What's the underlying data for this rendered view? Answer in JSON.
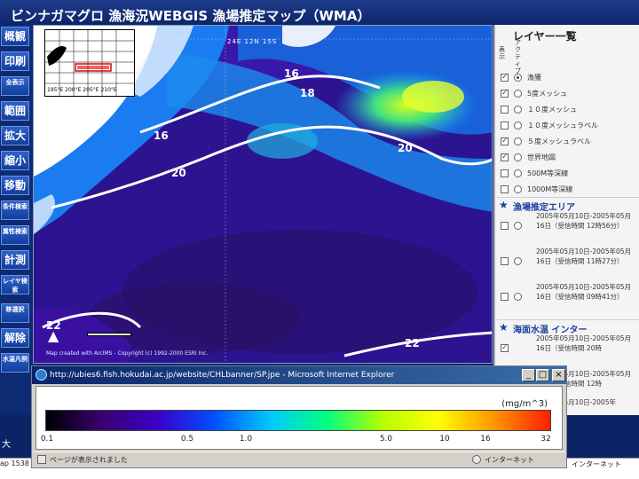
{
  "title": "ビンナガマグロ 漁海況WEBGIS 漁場推定マップ（WMA）",
  "toolbar": [
    "概観",
    "印刷",
    "全表示",
    "範囲",
    "拡大",
    "縮小",
    "移動",
    "条件検索",
    "属性検索",
    "計測",
    "レイヤ検索",
    "移選択",
    "解除",
    "水温凡例"
  ],
  "map": {
    "contour_labels": [
      "16",
      "18",
      "20",
      "20",
      "16",
      "22",
      "22"
    ],
    "coordinate_readout": "24E 12N 15S",
    "copyright": "Map created with ArcIMS - Copyright (c) 1992-2000 ESRI Inc.",
    "north_label": "N",
    "inset_label": "195°E 200°E 205°E 210°E"
  },
  "layer_panel": {
    "title": "レイヤー一覧",
    "col_headers": [
      "表示",
      "アクティブ"
    ],
    "layers": [
      {
        "label": "漁獲",
        "checked": true,
        "active": true
      },
      {
        "label": "5度メッシュ",
        "checked": true,
        "active": false
      },
      {
        "label": "１０度メッシュ",
        "checked": false,
        "active": false
      },
      {
        "label": "１０度メッシュラベル",
        "checked": false,
        "active": false
      },
      {
        "label": "５度メッシュラベル",
        "checked": true,
        "active": false
      },
      {
        "label": "世界地図",
        "checked": true,
        "active": false
      },
      {
        "label": "500M等深線",
        "checked": false,
        "active": false
      },
      {
        "label": "1000M等深線",
        "checked": false,
        "active": false
      }
    ],
    "section_fishing": "漁場推定エリア",
    "fishing_areas": [
      "2005年05月10日-2005年05月16日（受信時間 12時56分）",
      "2005年05月10日-2005年05月16日（受信時間 11時27分）",
      "2005年05月10日-2005年05月16日（受信時間 09時41分）"
    ],
    "section_sst": "海面水温 インター",
    "sst_items": [
      "2005年05月10日-2005年05月16日（受信時間 20時",
      "2005年05月10日-2005年05月16日（受信時間 12時",
      "2005年05月10日-2005年"
    ]
  },
  "popup": {
    "title": "http://ubies6.fish.hokudai.ac.jp/website/CHLbanner/SP.jpe - Microsoft Internet Explorer",
    "unit": "(mg/m^3)",
    "ticks": [
      "0.1",
      "0.5",
      "1.0",
      "5.0",
      "10",
      "16",
      "32"
    ],
    "status_left": "ページが表示されました",
    "status_right": "インターネット",
    "colors": [
      "#000000",
      "#3a0070",
      "#3a00c8",
      "#0050ff",
      "#00c8ff",
      "#00ff80",
      "#b4ff00",
      "#ffff00",
      "#ff9600",
      "#ff1e00"
    ]
  },
  "bottom": {
    "left_text": "ap 1538",
    "right_text": "インターネット",
    "big_char": "大"
  }
}
